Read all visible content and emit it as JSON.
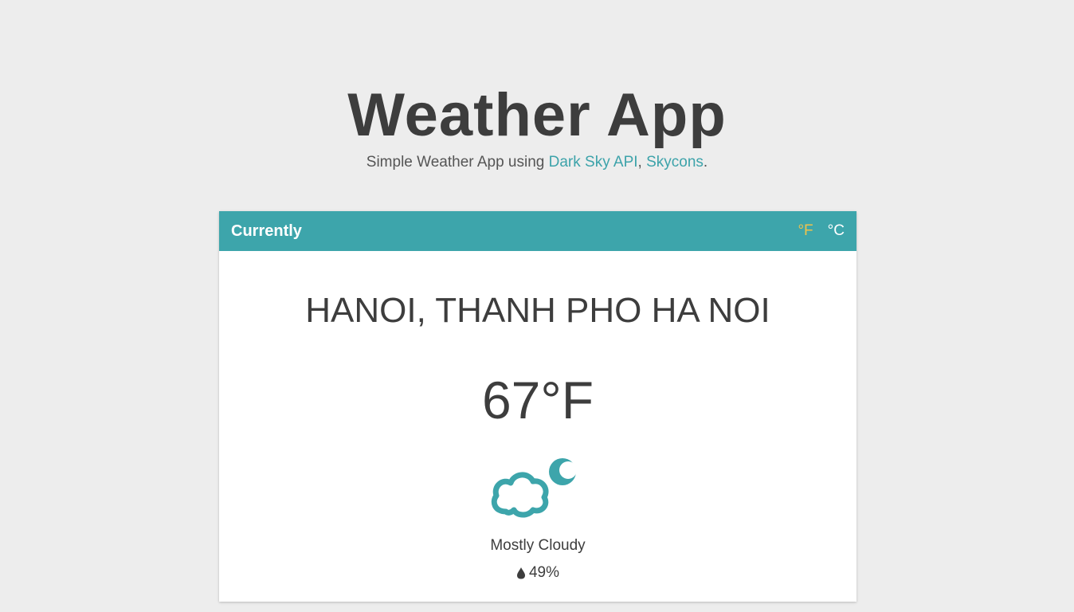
{
  "header": {
    "title": "Weather App",
    "subtitle_prefix": "Simple Weather App using ",
    "link_darksky": "Dark Sky API",
    "subtitle_sep": ", ",
    "link_skycons": "Skycons",
    "subtitle_suffix": "."
  },
  "card": {
    "header_title": "Currently",
    "unit_f": "°F",
    "unit_c": "°C",
    "location": "HANOI, THANH PHO HA NOI",
    "temperature": "67°F",
    "icon": "partly-cloudy-night-icon",
    "summary": "Mostly Cloudy",
    "humidity": "49%"
  },
  "colors": {
    "accent": "#3da5ab",
    "active_unit": "#f0c24b",
    "background": "#ededed",
    "text": "#3d3d3d"
  }
}
